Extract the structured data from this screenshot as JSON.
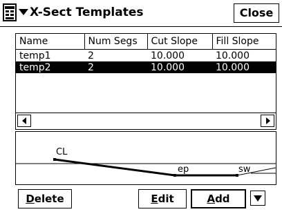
{
  "titlebar": {
    "title": "X-Sect Templates",
    "close_label": "Close"
  },
  "table": {
    "headers": [
      "Name",
      "Num Segs",
      "Cut Slope",
      "Fill Slope"
    ],
    "rows": [
      [
        "temp1",
        "2",
        "10.000",
        "10.000"
      ],
      [
        "temp2",
        "2",
        "10.000",
        "10.000"
      ]
    ],
    "selected_row": 1
  },
  "preview": {
    "labels": {
      "cl": "CL",
      "ep": "ep",
      "sw": "sw"
    }
  },
  "buttons": {
    "delete_hot": "D",
    "delete_rest": "elete",
    "edit_hot": "E",
    "edit_rest": "dit",
    "add_hot": "A",
    "add_rest": "dd"
  },
  "colors": {
    "selection": "#000000",
    "background": "#ffffff"
  },
  "icons": {
    "menu": "start-menu-icon",
    "dropdown": "chevron-down-icon"
  }
}
